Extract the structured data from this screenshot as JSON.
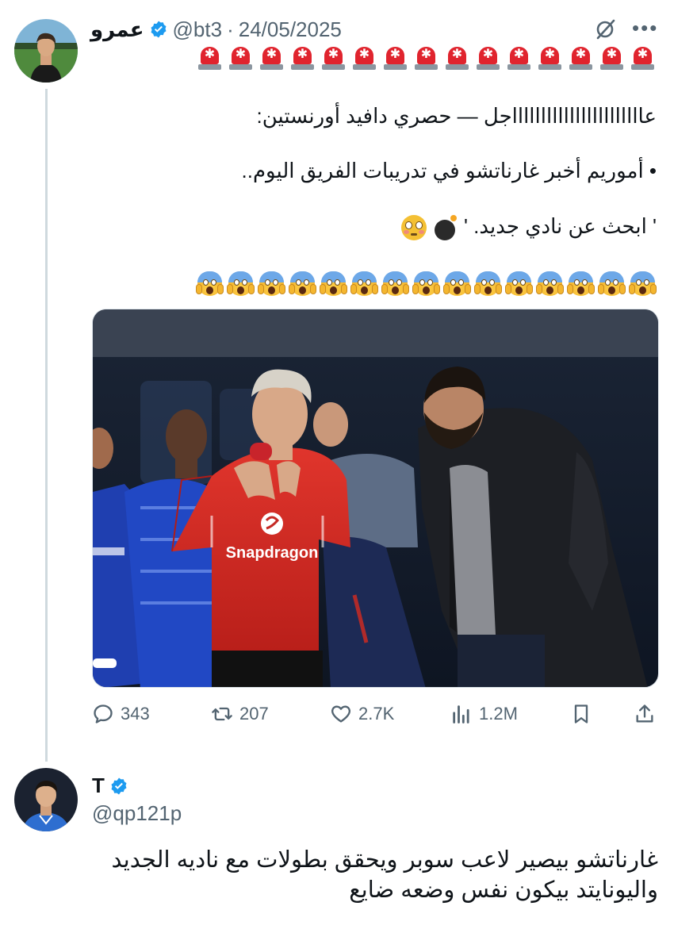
{
  "tweet": {
    "author": {
      "name": "عمرو",
      "handle": "@bt3",
      "separator": "·",
      "date": "24/05/2025"
    },
    "siren_count": 15,
    "lines": [
      "عاااااااااااااااااااااااجل — حصري دافيد أورنستين:",
      "• أموريم أخبر غارناتشو في تدريبات الفريق اليوم..",
      "' ابحث عن نادي جديد. '"
    ],
    "scream_count": 15,
    "photo": {
      "jersey_sponsor": "Snapdragon"
    },
    "actions": {
      "replies": "343",
      "reposts": "207",
      "likes": "2.7K",
      "views": "1.2M"
    }
  },
  "reply": {
    "author": {
      "name": "T",
      "handle": "@qp121p"
    },
    "text_line1": "غارناتشو بيصير لاعب سوبر ويحقق بطولات  مع ناديه الجديد",
    "text_line2": "واليونايتد بيكون نفس وضعه ضايع"
  },
  "icons": {
    "verified": "verified-badge-icon",
    "grok": "grok-icon",
    "more": "more-icon",
    "siren": "police-siren-emoji",
    "scream": "face-screaming-emoji",
    "bomb": "bomb-emoji",
    "flushed": "flushed-face-emoji",
    "reply": "reply-icon",
    "repost": "repost-icon",
    "like": "heart-icon",
    "views": "views-icon",
    "bookmark": "bookmark-icon",
    "share": "share-icon"
  },
  "colors": {
    "accent": "#1d9bf0",
    "secondary_text": "#536471",
    "siren_red": "#e0242e",
    "jersey_red": "#d42a23"
  }
}
